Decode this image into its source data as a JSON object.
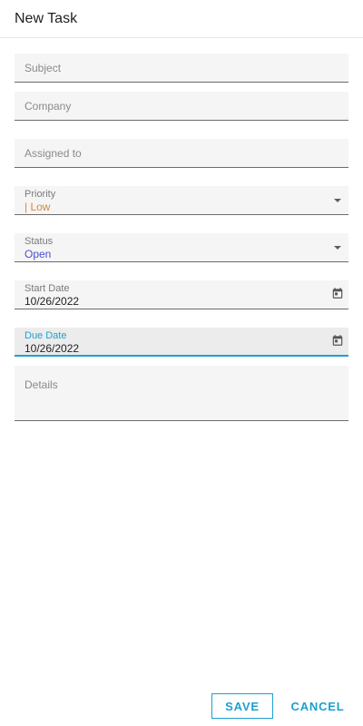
{
  "header": {
    "title": "New Task"
  },
  "form": {
    "subject": {
      "placeholder": "Subject"
    },
    "company": {
      "placeholder": "Company"
    },
    "assigned_to": {
      "placeholder": "Assigned to"
    },
    "priority": {
      "label": "Priority",
      "value": "| Low"
    },
    "status": {
      "label": "Status",
      "value": "Open"
    },
    "start_date": {
      "label": "Start Date",
      "value": "10/26/2022"
    },
    "due_date": {
      "label": "Due Date",
      "value": "10/26/2022"
    },
    "details": {
      "placeholder": "Details"
    }
  },
  "actions": {
    "save_label": "SAVE",
    "cancel_label": "CANCEL"
  },
  "colors": {
    "accent": "#1ea0d6",
    "priority_low": "#d4883a",
    "status_open": "#4a4fd1"
  },
  "icons": {
    "dropdown": "chevron-down-icon",
    "calendar": "calendar-icon"
  }
}
